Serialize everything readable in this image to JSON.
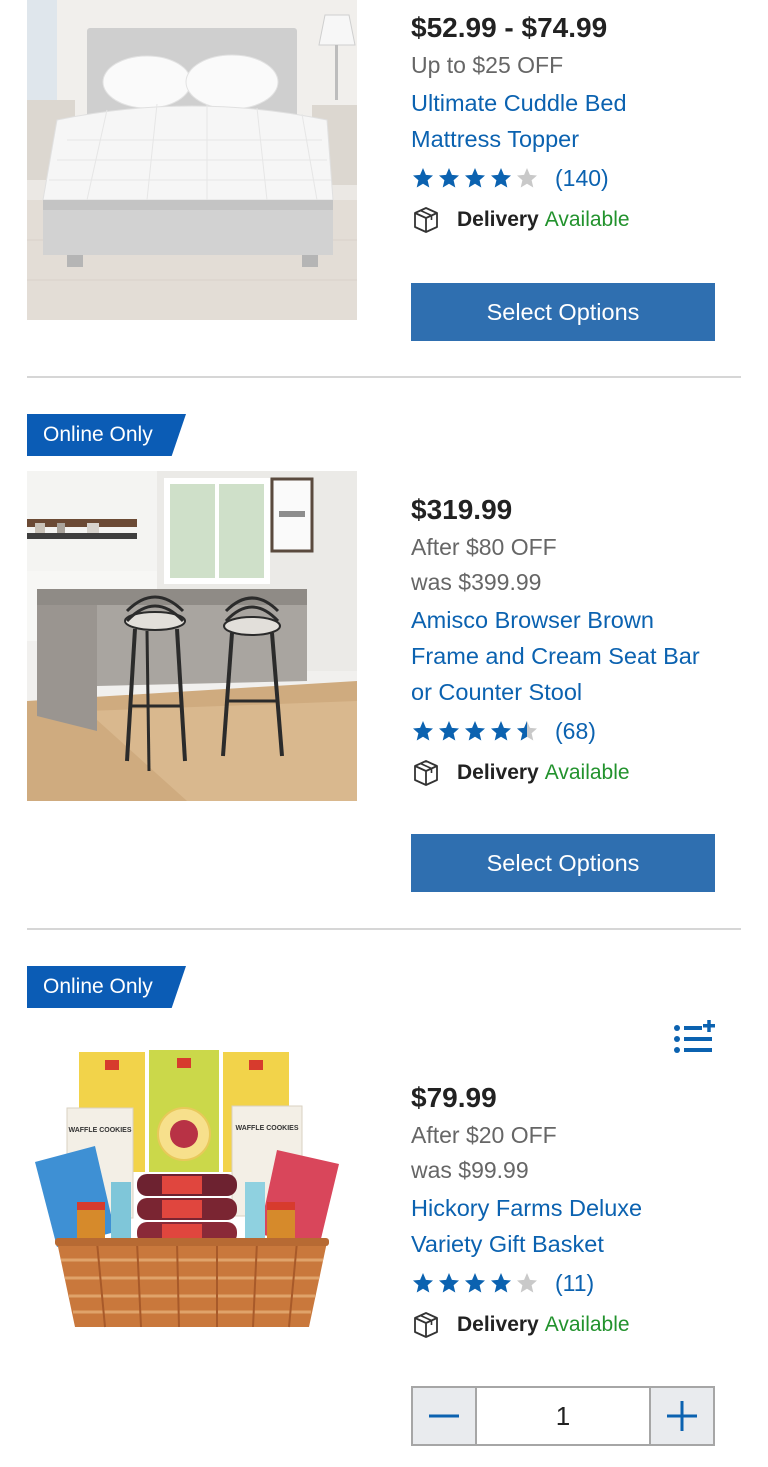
{
  "colors": {
    "link_blue": "#0b62b0",
    "button_blue": "#2f6fb0",
    "badge_blue": "#0b5cb5",
    "star_blue": "#0b62b0",
    "star_empty": "#c9c9c9",
    "available_green": "#22922d"
  },
  "products": [
    {
      "price": "$52.99 - $74.99",
      "discount": "Up to $25 OFF",
      "title_lines": [
        "Ultimate Cuddle Bed",
        "Mattress Topper"
      ],
      "rating": 4,
      "review_count": "(140)",
      "delivery_label": "Delivery",
      "delivery_status": "Available",
      "button_label": "Select Options",
      "image_icon": "mattress-topper-image"
    },
    {
      "badge": "Online Only",
      "price": "$319.99",
      "discount": "After $80 OFF",
      "was_price": "was $399.99",
      "title_lines": [
        "Amisco Browser Brown",
        "Frame and Cream Seat Bar",
        "or Counter Stool"
      ],
      "rating": 4.5,
      "review_count": "(68)",
      "delivery_label": "Delivery",
      "delivery_status": "Available",
      "button_label": "Select Options",
      "image_icon": "bar-stool-kitchen-image"
    },
    {
      "badge": "Online Only",
      "price": "$79.99",
      "discount": "After $20 OFF",
      "was_price": "was $99.99",
      "title_lines": [
        "Hickory Farms Deluxe",
        "Variety Gift Basket"
      ],
      "rating": 4,
      "review_count": "(11)",
      "delivery_label": "Delivery",
      "delivery_status": "Available",
      "quantity": "1",
      "image_icon": "gift-basket-image",
      "image_texts": [
        "WAFFLE COOKIES",
        "WAFFLE COOKIES"
      ]
    }
  ]
}
